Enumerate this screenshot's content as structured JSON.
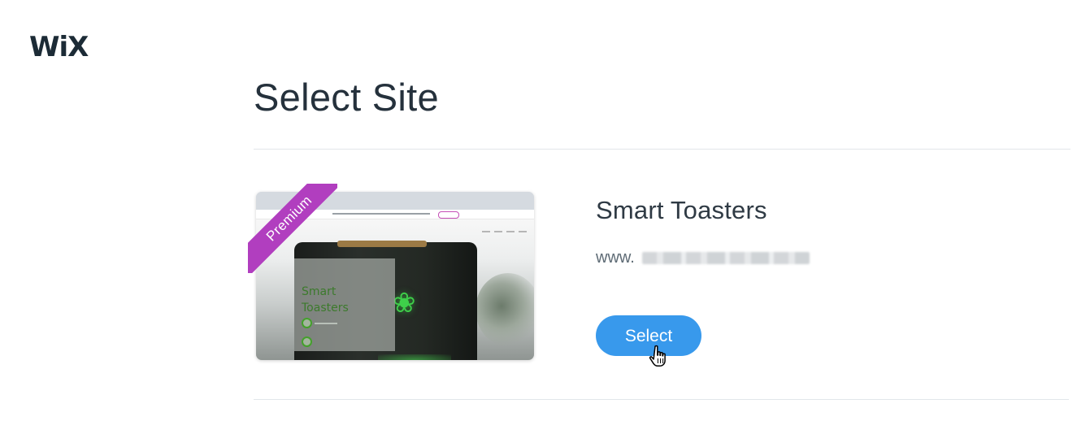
{
  "brand": {
    "logo_text": "WiX"
  },
  "page": {
    "title": "Select Site"
  },
  "site": {
    "name": "Smart Toasters",
    "url_prefix": "www.",
    "badge": "Premium",
    "thumbnail_title": "Smart Toasters",
    "select_label": "Select"
  },
  "colors": {
    "badge": "#b13ebf",
    "button": "#3899ec",
    "title": "#25313c"
  },
  "icons": {
    "cursor": "hand-pointer-icon"
  }
}
